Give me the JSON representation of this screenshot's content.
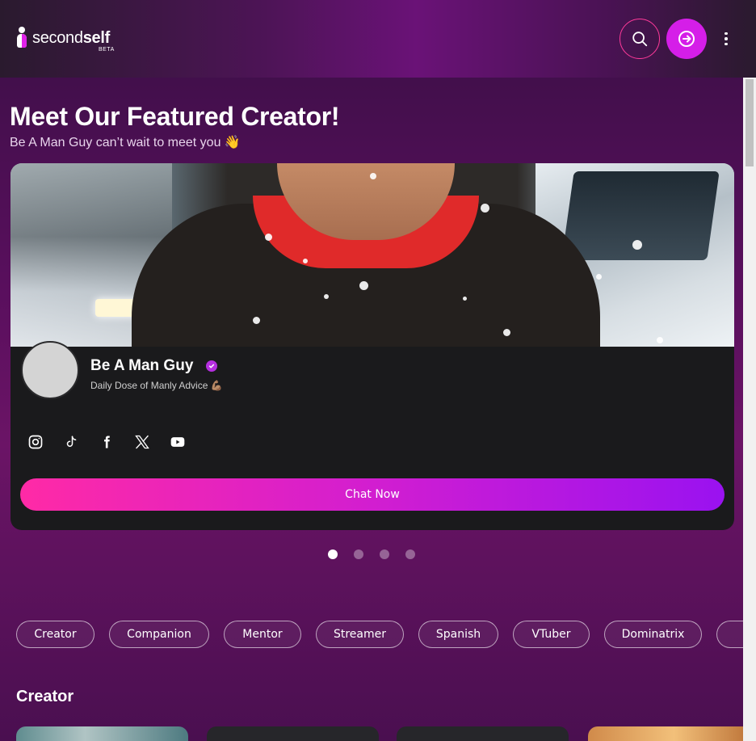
{
  "header": {
    "logo_light": "second",
    "logo_bold": "self",
    "logo_badge": "BETA",
    "search_icon": "search-icon",
    "login_icon": "login-icon",
    "menu_icon": "more-vertical-icon"
  },
  "featured": {
    "title": "Meet Our Featured Creator!",
    "subtitle": "Be A Man Guy can’t wait to meet you 👋",
    "creator_name": "Be A Man Guy",
    "creator_tagline": "Daily Dose of Manly Advice 💪🏽",
    "verified_icon": "verified-badge-icon",
    "socials": [
      "instagram-icon",
      "tiktok-icon",
      "facebook-icon",
      "x-icon",
      "youtube-icon"
    ],
    "cta_label": "Chat Now",
    "carousel_pages": 4,
    "carousel_active": 1
  },
  "categories": [
    "Creator",
    "Companion",
    "Mentor",
    "Streamer",
    "Spanish",
    "VTuber",
    "Dominatrix",
    ""
  ],
  "section": {
    "title": "Creator"
  },
  "colors": {
    "accent": "#d51ee8",
    "search_border": "#ff3a9a",
    "cta_start": "#ff2aa6",
    "cta_end": "#9a12f0"
  }
}
